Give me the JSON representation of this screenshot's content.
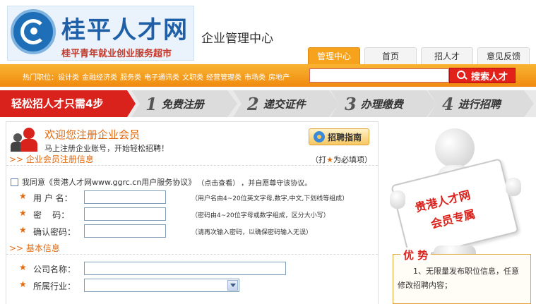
{
  "header": {
    "logo_title": "桂平人才网",
    "logo_slogan": "桂平青年就业创业服务超市",
    "center_title": "企业管理中心",
    "tabs": [
      {
        "label": "管理中心",
        "active": true
      },
      {
        "label": "首页",
        "active": false
      },
      {
        "label": "招人才",
        "active": false
      },
      {
        "label": "意见反馈",
        "active": false
      }
    ]
  },
  "hotbar": {
    "prefix": "热门职位：",
    "items": [
      "设计类",
      "金融经济类",
      "服务类",
      "电子通讯类",
      "文职类",
      "经营管理类",
      "市场类",
      "房地产"
    ],
    "search_placeholder": "",
    "search_button": "搜索人才"
  },
  "steps": {
    "intro": "轻松招人才只需4步",
    "items": [
      {
        "num": "1",
        "label": "免费注册"
      },
      {
        "num": "2",
        "label": "递交证件"
      },
      {
        "num": "3",
        "label": "办理缴费"
      },
      {
        "num": "4",
        "label": "进行招聘"
      }
    ]
  },
  "welcome": {
    "title": "欢迎您注册企业会员",
    "subtitle": "马上注册企业账号，开始轻松招聘！",
    "guide_button": "招聘指南"
  },
  "section_member": {
    "title": ">> 企业会员注册信息",
    "required_prefix": "（打",
    "required_star": "★",
    "required_suffix": "为必填项）"
  },
  "agreement": {
    "text1": "我同意《贵港人才网www.ggrc.cn用户服务协议》",
    "text2": "（点击查看）",
    "text3": "，并自愿尊守该协议。"
  },
  "form": {
    "username": {
      "label": "用 户 名：",
      "hint": "（用户名由4~20位英文字母,数字,中文,下划线等组成）"
    },
    "password": {
      "label": "密    码：",
      "hint": "（密码由4~20位字母或数字组成，区分大小写）"
    },
    "confirm": {
      "label": "确认密码：",
      "hint": "（请再次输入密码，以确保密码输入无误）"
    },
    "star": "★"
  },
  "section_basic": {
    "title": ">> 基本信息"
  },
  "basic": {
    "company": {
      "label": "公司名称："
    },
    "industry": {
      "label": "所属行业：",
      "value": ""
    }
  },
  "promo": {
    "line1": "贵港人才网",
    "line2": "会员专属"
  },
  "advantage": {
    "title": "优 势",
    "text": "1、无限量发布职位信息，任意修改招聘内容；"
  },
  "colors": {
    "accent_orange": "#ef8a10",
    "brand_red": "#d9221b",
    "brand_blue": "#1f5fa8"
  }
}
